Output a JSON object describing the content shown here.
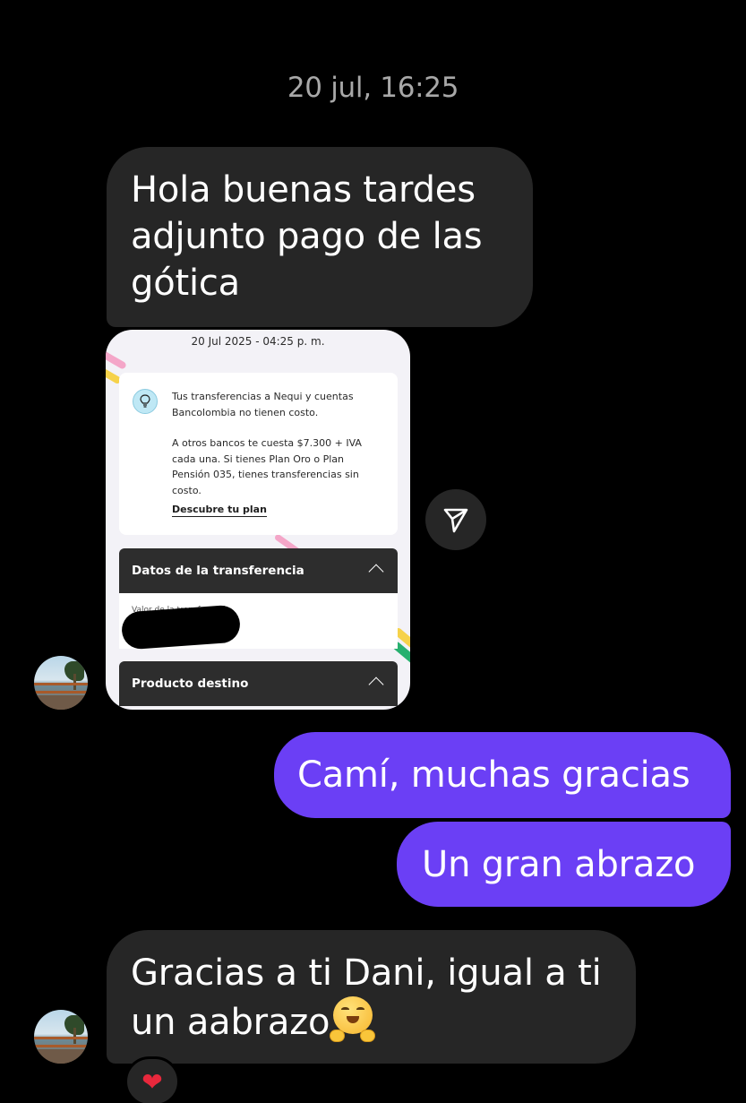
{
  "conversation": {
    "timestamp": "20 jul, 16:25",
    "messages": [
      {
        "direction": "incoming",
        "text": "Hola buenas tardes adjunto pago de las gótica"
      },
      {
        "direction": "incoming",
        "type": "image",
        "shared_screenshot": {
          "date": "20 Jul 2025 - 04:25 p. m.",
          "info_paragraph_1": "Tus transferencias a Nequi y cuentas Bancolombia no tienen costo.",
          "info_paragraph_2": "A otros bancos te cuesta $7.300 + IVA cada una. Si tienes Plan Oro o Plan Pensión 035, tienes transferencias sin costo.",
          "info_link": "Descubre tu plan",
          "section_1_title": "Datos de la transferencia",
          "section_1_field_label": "Valor de la transferencia",
          "section_2_title": "Producto destino"
        }
      },
      {
        "direction": "outgoing",
        "text": "Camí, muchas gracias"
      },
      {
        "direction": "outgoing",
        "text": "Un gran abrazo"
      },
      {
        "direction": "incoming",
        "text": "Gracias a ti Dani, igual a ti un aabrazo",
        "emoji": "hugging-face-emoji",
        "reaction": "❤"
      }
    ]
  },
  "colors": {
    "background": "#000000",
    "incoming_bubble": "#262626",
    "outgoing_bubble": "#6b3ff5",
    "timestamp_text": "#a8a8a8"
  }
}
